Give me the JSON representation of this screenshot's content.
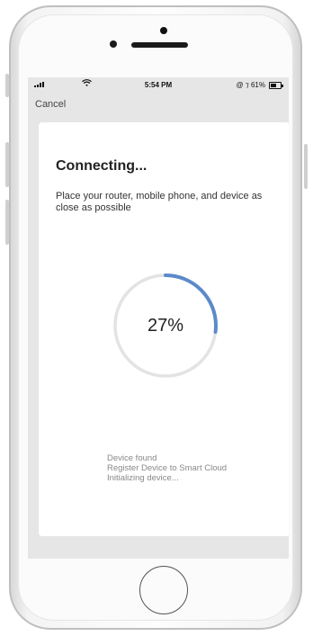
{
  "status_bar": {
    "time": "5:54 PM",
    "right_text": "@ ⁊ 61%",
    "battery_percent": 61
  },
  "nav": {
    "cancel_label": "Cancel"
  },
  "connecting": {
    "title": "Connecting...",
    "subtitle": "Place your router, mobile phone, and device as close as possible",
    "progress_percent": 27,
    "progress_label": "27%",
    "steps": [
      "Device found",
      "Register Device to Smart Cloud",
      "Initializing device..."
    ]
  },
  "colors": {
    "progress_arc": "#5b8ac9",
    "progress_track": "#e3e3e3",
    "screen_bg": "#e6e6e6",
    "card_bg": "#ffffff"
  }
}
